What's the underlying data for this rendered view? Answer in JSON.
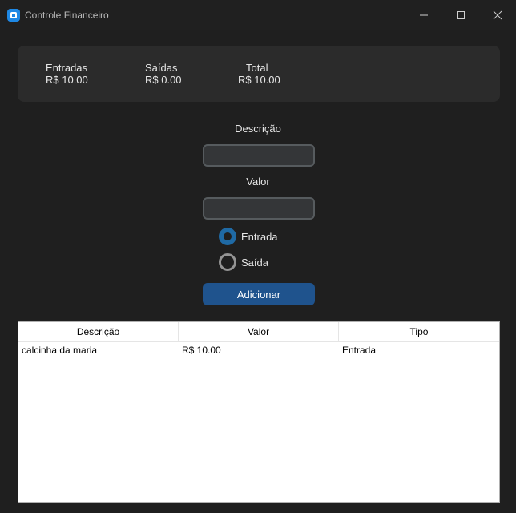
{
  "window": {
    "title": "Controle Financeiro"
  },
  "summary": {
    "entradas": {
      "label": "Entradas",
      "value": "R$ 10.00"
    },
    "saidas": {
      "label": "Saídas",
      "value": "R$ 0.00"
    },
    "total": {
      "label": "Total",
      "value": "R$ 10.00"
    }
  },
  "form": {
    "descricao_label": "Descrição",
    "descricao_value": "",
    "valor_label": "Valor",
    "valor_value": "",
    "radio_entrada": "Entrada",
    "radio_saida": "Saída",
    "selected_type": "Entrada",
    "add_button": "Adicionar"
  },
  "table": {
    "columns": [
      "Descrição",
      "Valor",
      "Tipo"
    ],
    "rows": [
      [
        "calcinha da maria",
        "R$ 10.00",
        "Entrada"
      ]
    ]
  },
  "colors": {
    "accent": "#1f538d",
    "radio_selected": "#1f6aa5",
    "background": "#1f1f1f",
    "panel": "#2b2b2b"
  }
}
